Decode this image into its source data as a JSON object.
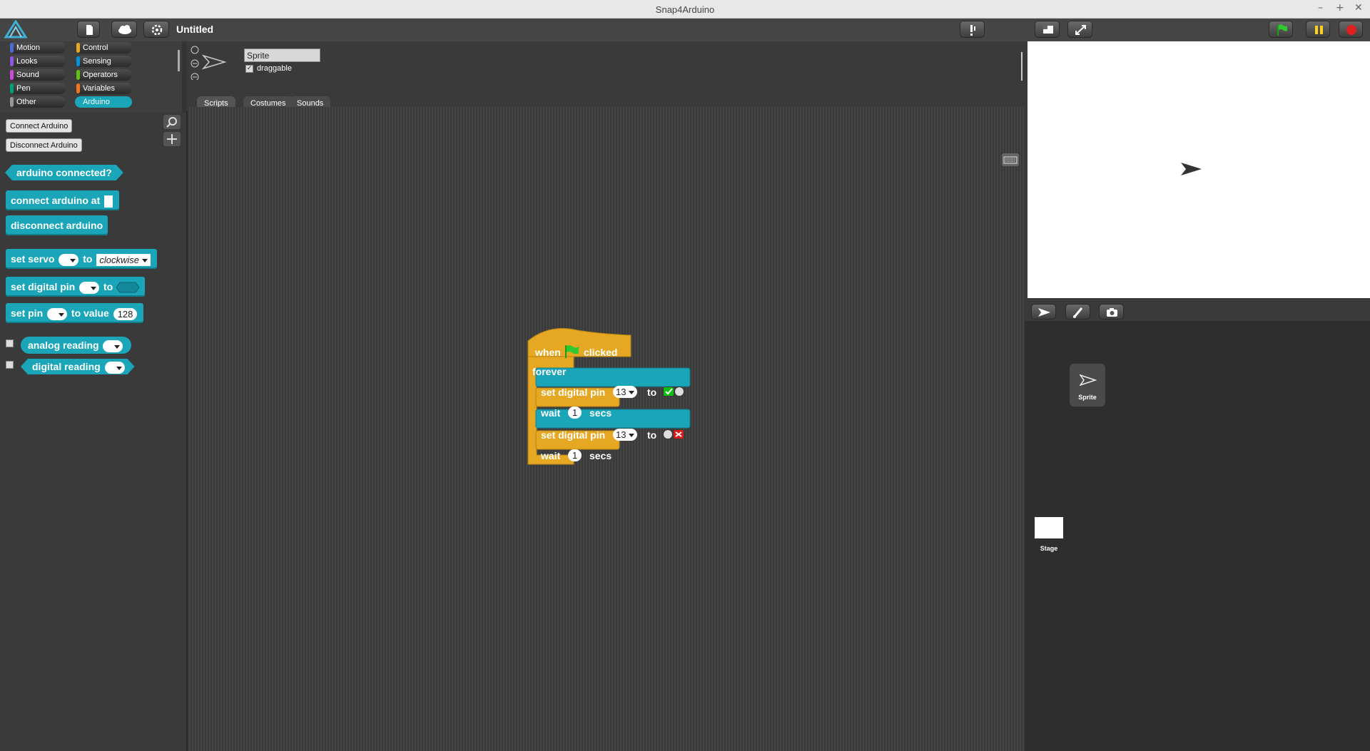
{
  "window": {
    "title": "Snap4Arduino",
    "controls": [
      "–",
      "+",
      "✕"
    ]
  },
  "topbar": {
    "project_title": "Untitled"
  },
  "categories": [
    {
      "label": "Motion",
      "color": "#4a6cd4"
    },
    {
      "label": "Control",
      "color": "#e6a822"
    },
    {
      "label": "Looks",
      "color": "#8f56e3"
    },
    {
      "label": "Sensing",
      "color": "#0494dc"
    },
    {
      "label": "Sound",
      "color": "#cf4ad9"
    },
    {
      "label": "Operators",
      "color": "#62c213"
    },
    {
      "label": "Pen",
      "color": "#00a178"
    },
    {
      "label": "Variables",
      "color": "#f3761d"
    },
    {
      "label": "Other",
      "color": "#969696"
    },
    {
      "label": "Arduino",
      "color": "#1aa5b8",
      "selected": true
    }
  ],
  "palette": {
    "connect_button": "Connect Arduino",
    "disconnect_button": "Disconnect Arduino",
    "blocks": {
      "connected": "arduino connected?",
      "connect_at": "connect arduino at",
      "disconnect": "disconnect arduino",
      "servo": "set servo",
      "servo_to": "to",
      "servo_value": "clockwise",
      "digital": "set digital pin",
      "digital_to": "to",
      "pwm": "set pin",
      "pwm_to": "to value",
      "pwm_value": "128",
      "analog": "analog reading",
      "digital_reading": "digital reading"
    }
  },
  "sprite": {
    "name": "Sprite",
    "draggable_label": "draggable",
    "draggable": true
  },
  "tabs": [
    {
      "label": "Scripts",
      "selected": true
    },
    {
      "label": "Costumes",
      "selected": false
    },
    {
      "label": "Sounds",
      "selected": false
    }
  ],
  "script": {
    "when": "when",
    "clicked": "clicked",
    "forever": "forever",
    "set1": {
      "label": "set digital pin",
      "pin": "13",
      "to": "to",
      "state": "on"
    },
    "wait1": {
      "label": "wait",
      "value": "1",
      "unit": "secs"
    },
    "set2": {
      "label": "set digital pin",
      "pin": "13",
      "to": "to",
      "state": "off"
    },
    "wait2": {
      "label": "wait",
      "value": "1",
      "unit": "secs"
    }
  },
  "corral": {
    "sprite_label": "Sprite",
    "stage_label": "Stage"
  }
}
